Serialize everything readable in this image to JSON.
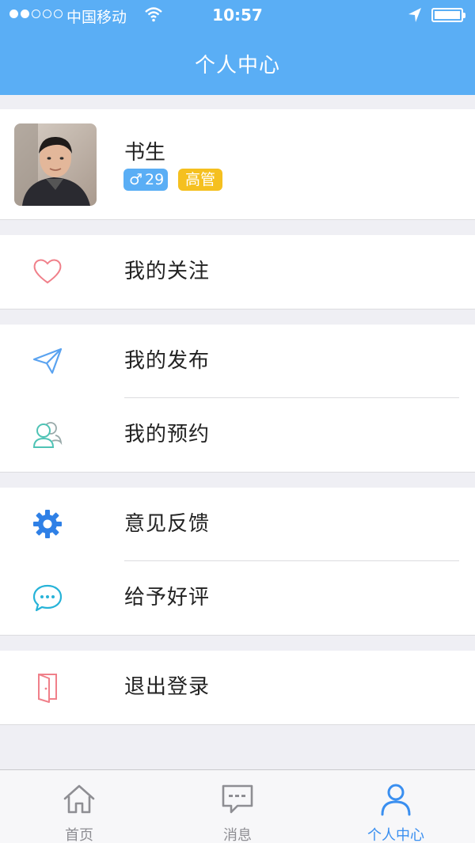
{
  "status_bar": {
    "carrier": "中国移动",
    "time": "10:57"
  },
  "header": {
    "title": "个人中心"
  },
  "profile": {
    "name": "书生",
    "gender_symbol": "♂",
    "age": "29",
    "title_badge": "高管"
  },
  "menu": {
    "follow": {
      "label": "我的关注",
      "icon": "heart-icon"
    },
    "publish": {
      "label": "我的发布",
      "icon": "paper-plane-icon"
    },
    "appointment": {
      "label": "我的预约",
      "icon": "users-icon"
    },
    "feedback": {
      "label": "意见反馈",
      "icon": "gear-icon"
    },
    "rate": {
      "label": "给予好评",
      "icon": "chat-bubble-icon"
    },
    "logout": {
      "label": "退出登录",
      "icon": "door-exit-icon"
    }
  },
  "tabbar": {
    "home": "首页",
    "messages": "消息",
    "profile": "个人中心"
  },
  "colors": {
    "header_bg": "#5aaef5",
    "age_badge": "#5aaef5",
    "title_badge": "#f5c01f",
    "active_tab": "#3a8ff0"
  }
}
